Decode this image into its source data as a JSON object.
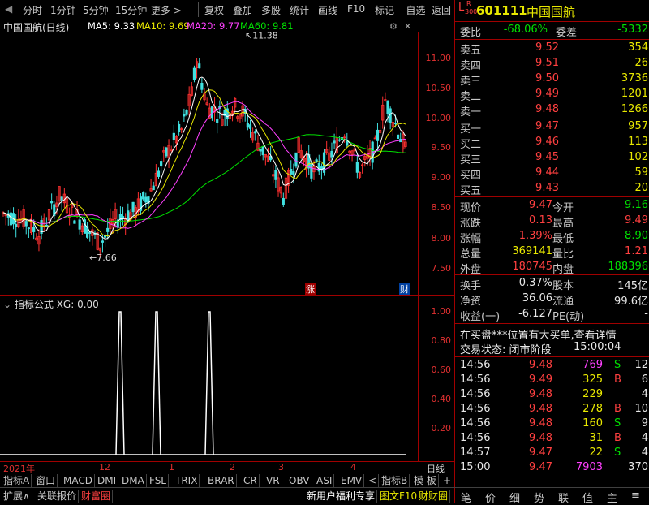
{
  "toolbar": {
    "items": [
      "分时",
      "1分钟",
      "5分钟",
      "15分钟",
      "更多 >",
      "复权",
      "叠加",
      "多股",
      "统计",
      "画线",
      "F10",
      "标记",
      "-自选",
      "返回"
    ]
  },
  "chart": {
    "title": "中国国航(日线)",
    "ma5": "MA5: 9.33",
    "ma10": "MA10: 9.69",
    "ma20": "MA20: 9.77",
    "ma60": "MA60: 9.81",
    "high_label": "11.38",
    "low_label": "7.66",
    "zhang": "涨",
    "cai": "财",
    "yticks": [
      "11.00",
      "10.50",
      "10.00",
      "9.50",
      "9.00",
      "8.50",
      "8.00",
      "7.50"
    ],
    "colors": {
      "ma5": "#ffffff",
      "ma10": "#e8e800",
      "ma20": "#ff40ff",
      "ma60": "#00e000",
      "up": "#ff3030",
      "down": "#40e0e0"
    }
  },
  "chart_data": {
    "type": "candlestick",
    "title": "中国国航(日线)",
    "series": [
      {
        "name": "MA5",
        "last": 9.33
      },
      {
        "name": "MA10",
        "last": 9.69
      },
      {
        "name": "MA20",
        "last": 9.77
      },
      {
        "name": "MA60",
        "last": 9.81
      }
    ],
    "high": 11.38,
    "low": 7.66,
    "ylim": [
      7.3,
      11.6
    ],
    "xticks": [
      "2021年",
      "12",
      "1",
      "2",
      "3",
      "4"
    ]
  },
  "indicator": {
    "title": "指标公式 XG: 0.00",
    "yticks": [
      "1.00",
      "0.80",
      "0.60",
      "0.40",
      "0.20"
    ],
    "spikes": [
      0.24,
      0.33,
      0.46
    ]
  },
  "dates": {
    "labels": [
      "2021年",
      "12",
      "1",
      "2",
      "3",
      "4"
    ],
    "right": "日线"
  },
  "tabs1": [
    "指标A",
    "窗口",
    "MACD",
    "DMI",
    "DMA",
    "FSL",
    "TRIX",
    "BRAR",
    "CR",
    "VR",
    "OBV",
    "ASI",
    "EMV",
    "<",
    "指标B",
    "模 板",
    "+",
    "-"
  ],
  "tabs2": {
    "left": [
      "扩展∧",
      "关联报价",
      "财富圈"
    ],
    "right": [
      "新用户福利专享",
      "图文F10",
      "财财圈"
    ]
  },
  "quote": {
    "code": "601111",
    "name": "中国国航",
    "badge_l": "L",
    "badge_r": "R",
    "badge_num": "300",
    "weibi_label": "委比",
    "weibi": "-68.06%",
    "weicha_label": "委差",
    "weicha": "-5332",
    "asks": [
      {
        "l": "卖五",
        "p": "9.52",
        "v": "354"
      },
      {
        "l": "卖四",
        "p": "9.51",
        "v": "26"
      },
      {
        "l": "卖三",
        "p": "9.50",
        "v": "3736"
      },
      {
        "l": "卖二",
        "p": "9.49",
        "v": "1201"
      },
      {
        "l": "卖一",
        "p": "9.48",
        "v": "1266"
      }
    ],
    "bids": [
      {
        "l": "买一",
        "p": "9.47",
        "v": "957"
      },
      {
        "l": "买二",
        "p": "9.46",
        "v": "113"
      },
      {
        "l": "买三",
        "p": "9.45",
        "v": "102"
      },
      {
        "l": "买四",
        "p": "9.44",
        "v": "59"
      },
      {
        "l": "买五",
        "p": "9.43",
        "v": "20"
      }
    ],
    "stats": [
      {
        "a": "现价",
        "b": "9.47",
        "c": "今开",
        "d": "9.16"
      },
      {
        "a": "涨跌",
        "b": "0.13",
        "c": "最高",
        "d": "9.49"
      },
      {
        "a": "涨幅",
        "b": "1.39%",
        "c": "最低",
        "d": "8.90"
      },
      {
        "a": "总量",
        "b": "369141",
        "c": "量比",
        "d": "1.21"
      },
      {
        "a": "外盘",
        "b": "180745",
        "c": "内盘",
        "d": "188396"
      }
    ],
    "stats2": [
      {
        "a": "换手",
        "b": "0.37%",
        "c": "股本",
        "d": "145亿"
      },
      {
        "a": "净资",
        "b": "36.06",
        "c": "流通",
        "d": "99.6亿"
      },
      {
        "a": "收益(一)",
        "b": "-6.127",
        "c": "PE(动)",
        "d": "-"
      }
    ],
    "notice": "在买盘***位置有大买单,查看详情",
    "status": "交易状态: 闭市阶段",
    "status_time": "15:00:04",
    "ticks": [
      {
        "t": "14:56",
        "p": "9.48",
        "v": "769",
        "s": "S",
        "n": "12"
      },
      {
        "t": "14:56",
        "p": "9.49",
        "v": "325",
        "s": "B",
        "n": "6"
      },
      {
        "t": "14:56",
        "p": "9.48",
        "v": "229",
        "s": "",
        "n": "4"
      },
      {
        "t": "14:56",
        "p": "9.48",
        "v": "278",
        "s": "B",
        "n": "10"
      },
      {
        "t": "14:56",
        "p": "9.48",
        "v": "160",
        "s": "S",
        "n": "9"
      },
      {
        "t": "14:56",
        "p": "9.48",
        "v": "31",
        "s": "B",
        "n": "4"
      },
      {
        "t": "14:57",
        "p": "9.47",
        "v": "22",
        "s": "S",
        "n": "4"
      },
      {
        "t": "15:00",
        "p": "9.47",
        "v": "7903",
        "s": "",
        "n": "370"
      }
    ],
    "bottom": [
      "笔",
      "价",
      "细",
      "势",
      "联",
      "值",
      "主",
      "≡"
    ]
  }
}
